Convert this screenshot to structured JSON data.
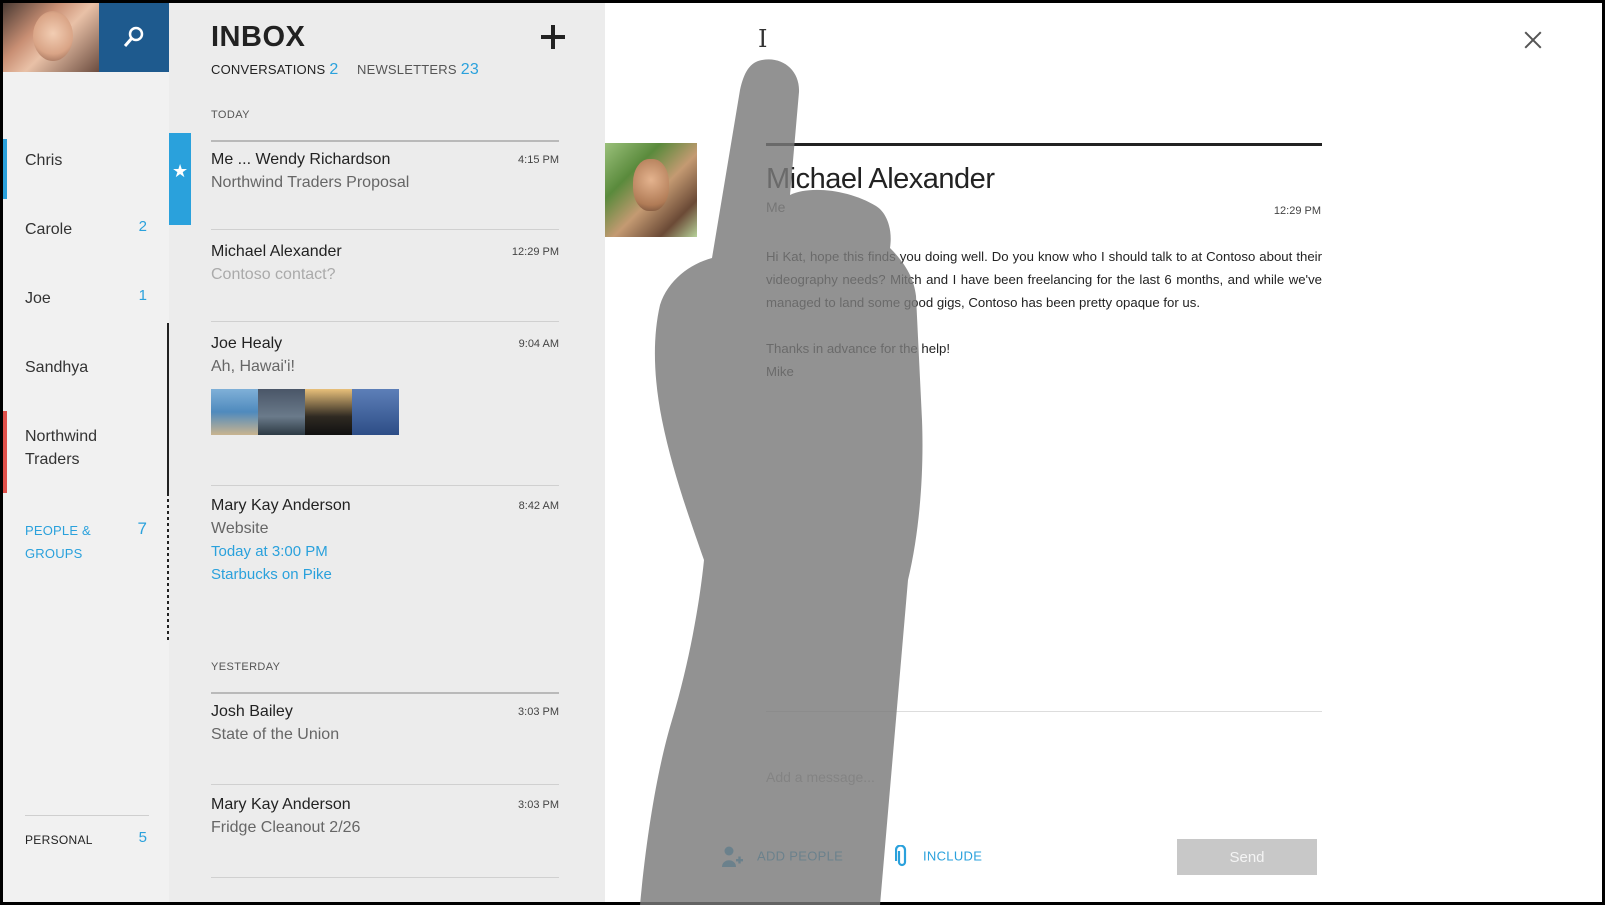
{
  "rail": {
    "items": [
      {
        "label": "Chris",
        "count": ""
      },
      {
        "label": "Carole",
        "count": "2"
      },
      {
        "label": "Joe",
        "count": "1"
      },
      {
        "label": "Sandhya",
        "count": ""
      },
      {
        "label": "Northwind Traders",
        "count": ""
      }
    ],
    "people_groups": {
      "label": "PEOPLE & GROUPS",
      "count": "7"
    },
    "personal": {
      "label": "PERSONAL",
      "count": "5"
    },
    "accent_colors": {
      "chris": "#2aa1dc",
      "northwind": "#e0504a"
    }
  },
  "inbox": {
    "title": "INBOX",
    "tabs": [
      {
        "label": "CONVERSATIONS",
        "count": "2"
      },
      {
        "label": "NEWSLETTERS",
        "count": "23"
      }
    ],
    "today_label": "TODAY",
    "yesterday_label": "YESTERDAY",
    "today": [
      {
        "sender": "Me ... Wendy Richardson",
        "time": "4:15 PM",
        "subject": "Northwind Traders Proposal",
        "flagged": true
      },
      {
        "sender": "Michael Alexander",
        "time": "12:29 PM",
        "subject": "Contoso contact?"
      },
      {
        "sender": "Joe Healy",
        "time": "9:04 AM",
        "subject": "Ah, Hawai'i!"
      },
      {
        "sender": "Mary Kay Anderson",
        "time": "8:42 AM",
        "subject": "Website",
        "line3": "Today at 3:00 PM",
        "line4": "Starbucks on Pike"
      }
    ],
    "yesterday": [
      {
        "sender": "Josh Bailey",
        "time": "3:03 PM",
        "subject": "State of the Union"
      },
      {
        "sender": "Mary Kay Anderson",
        "time": "3:03 PM",
        "subject": "Fridge Cleanout 2/26"
      }
    ]
  },
  "reading": {
    "from": "Michael Alexander",
    "to": "Me",
    "time": "12:29 PM",
    "body_p1": "Hi Kat, hope this finds you doing well.  Do you know who I should talk to at Contoso about their videography needs?  Mitch and I have been freelancing for the last 6 months, and while we've managed to land some good gigs, Contoso has been pretty opaque for us.",
    "body_p2": "Thanks in advance for the help!",
    "signature": "Mike",
    "compose_placeholder": "Add a message...",
    "add_people": "ADD PEOPLE",
    "include": "INCLUDE",
    "send": "Send"
  },
  "theme": {
    "accent": "#2aa1dc",
    "search_tile": "#1e5a8e"
  }
}
